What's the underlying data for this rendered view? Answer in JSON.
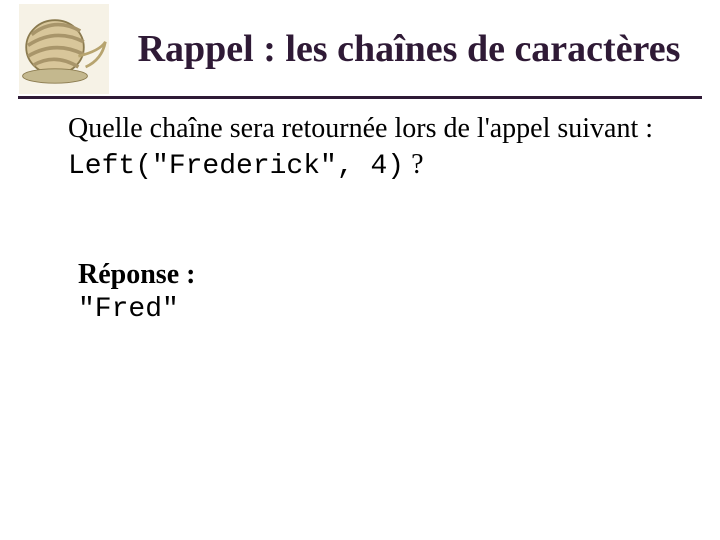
{
  "title": "Rappel : les chaînes de caractères",
  "icon_alt": "ball-of-twine",
  "question": {
    "intro_part1": "Quelle chaîne sera retournée lors de l'appel suivant :",
    "code": "Left(\"Frederick\", 4)",
    "trailing_qmark": "?"
  },
  "answer": {
    "label": "Réponse :",
    "value": "\"Fred\""
  }
}
